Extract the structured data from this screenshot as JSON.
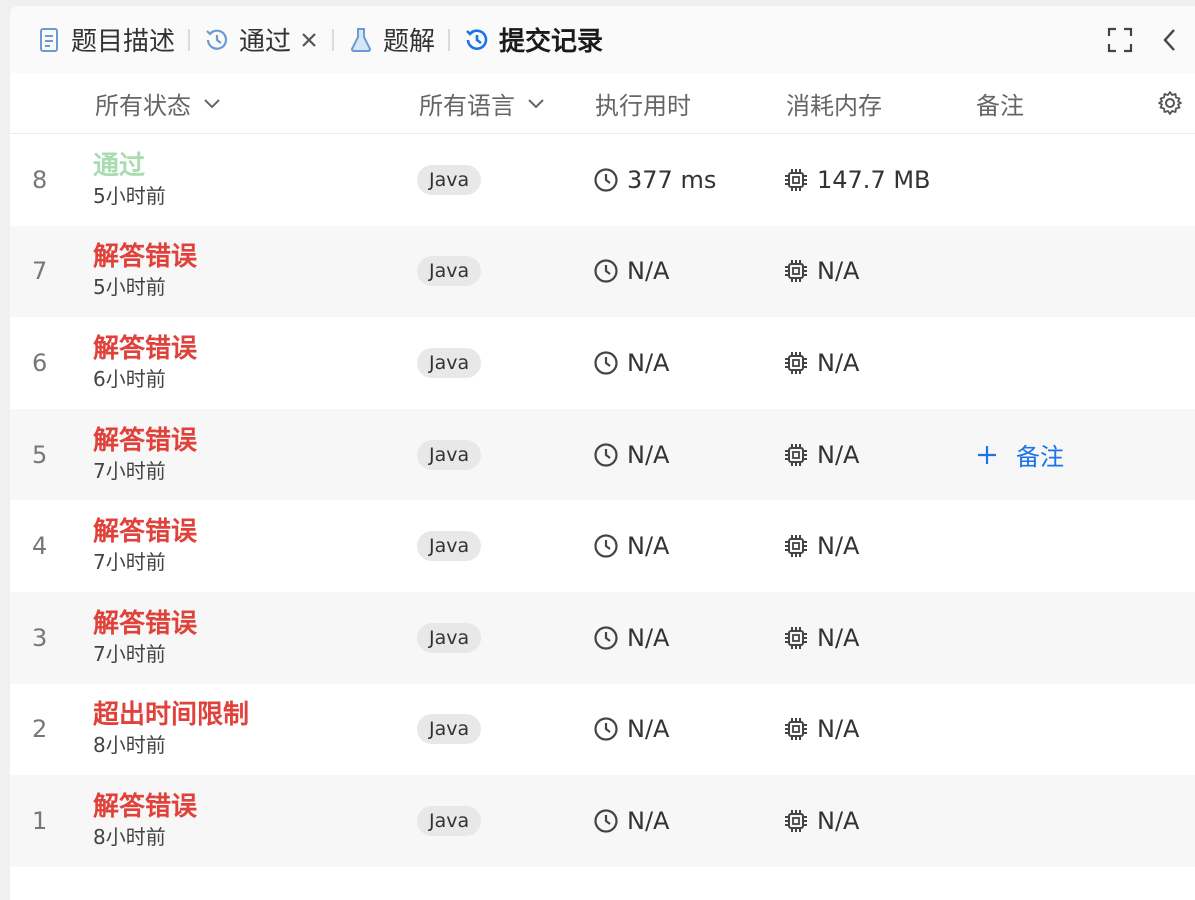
{
  "tabs": {
    "description": "题目描述",
    "passed": "通过",
    "solutions": "题解",
    "submissions": "提交记录"
  },
  "header": {
    "status_filter": "所有状态",
    "language_filter": "所有语言",
    "runtime": "执行用时",
    "memory": "消耗内存",
    "note": "备注"
  },
  "colors": {
    "accepted": "#a8dcb1",
    "error": "#e0413a",
    "accent": "#1a73e8"
  },
  "rows": [
    {
      "index": "8",
      "status": "通过",
      "status_type": "ok",
      "time_ago": "5小时前",
      "language": "Java",
      "runtime": "377 ms",
      "memory": "147.7 MB",
      "note": ""
    },
    {
      "index": "7",
      "status": "解答错误",
      "status_type": "bad",
      "time_ago": "5小时前",
      "language": "Java",
      "runtime": "N/A",
      "memory": "N/A",
      "note": ""
    },
    {
      "index": "6",
      "status": "解答错误",
      "status_type": "bad",
      "time_ago": "6小时前",
      "language": "Java",
      "runtime": "N/A",
      "memory": "N/A",
      "note": ""
    },
    {
      "index": "5",
      "status": "解答错误",
      "status_type": "bad",
      "time_ago": "7小时前",
      "language": "Java",
      "runtime": "N/A",
      "memory": "N/A",
      "note": "备注"
    },
    {
      "index": "4",
      "status": "解答错误",
      "status_type": "bad",
      "time_ago": "7小时前",
      "language": "Java",
      "runtime": "N/A",
      "memory": "N/A",
      "note": ""
    },
    {
      "index": "3",
      "status": "解答错误",
      "status_type": "bad",
      "time_ago": "7小时前",
      "language": "Java",
      "runtime": "N/A",
      "memory": "N/A",
      "note": ""
    },
    {
      "index": "2",
      "status": "超出时间限制",
      "status_type": "bad",
      "time_ago": "8小时前",
      "language": "Java",
      "runtime": "N/A",
      "memory": "N/A",
      "note": ""
    },
    {
      "index": "1",
      "status": "解答错误",
      "status_type": "bad",
      "time_ago": "8小时前",
      "language": "Java",
      "runtime": "N/A",
      "memory": "N/A",
      "note": ""
    }
  ]
}
